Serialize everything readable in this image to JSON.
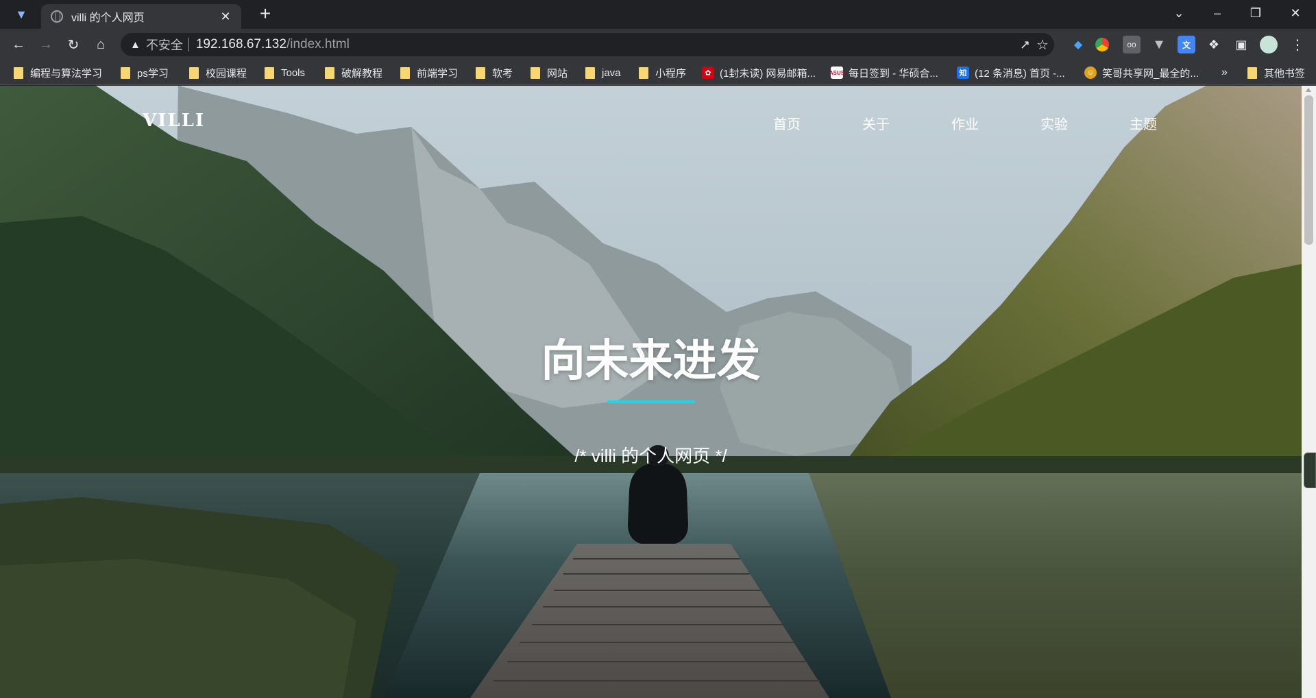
{
  "browser": {
    "tab_title": "villi 的个人网页",
    "url_warning": "不安全",
    "url_host": "192.168.67.132",
    "url_path": "/index.html"
  },
  "bookmarks": [
    {
      "label": "编程与算法学习",
      "kind": "folder"
    },
    {
      "label": "ps学习",
      "kind": "folder"
    },
    {
      "label": "校园课程",
      "kind": "folder"
    },
    {
      "label": "Tools",
      "kind": "folder"
    },
    {
      "label": "破解教程",
      "kind": "folder"
    },
    {
      "label": "前端学习",
      "kind": "folder"
    },
    {
      "label": "软考",
      "kind": "folder"
    },
    {
      "label": "网站",
      "kind": "folder"
    },
    {
      "label": "java",
      "kind": "folder"
    },
    {
      "label": "小程序",
      "kind": "folder"
    },
    {
      "label": "(1封未读) 网易邮箱...",
      "kind": "site",
      "icon": "netease-mail-icon",
      "color": "#d7000f"
    },
    {
      "label": "每日签到 - 华硕合...",
      "kind": "site",
      "icon": "asus-icon",
      "color": "#c8102e"
    },
    {
      "label": "(12 条消息) 首页 -...",
      "kind": "site",
      "icon": "zhihu-icon",
      "color": "#1772f6",
      "glyph": "知"
    },
    {
      "label": "笑哥共享网_最全的...",
      "kind": "site",
      "icon": "xiaoge-icon",
      "color": "#e0a21b"
    },
    {
      "label": "»",
      "kind": "more"
    },
    {
      "label": "其他书签",
      "kind": "folder"
    }
  ],
  "site": {
    "logo": "VILLI",
    "nav": [
      "首页",
      "关于",
      "作业",
      "实验",
      "主题"
    ],
    "hero_title": "向未来进发",
    "hero_subtitle": "/* villi 的个人网页 */",
    "accent_color": "#20d4e6"
  }
}
